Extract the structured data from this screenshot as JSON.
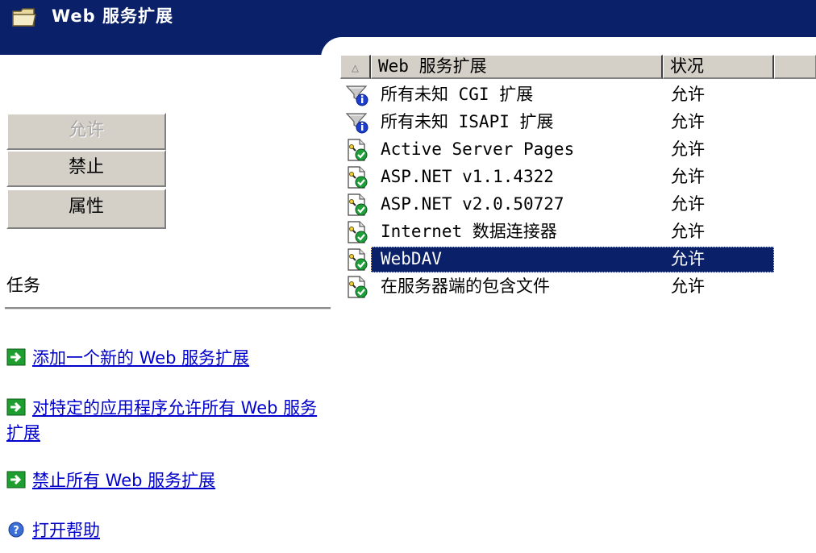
{
  "header": {
    "title": "Web 服务扩展"
  },
  "left_panel": {
    "buttons": [
      {
        "label": "允许",
        "enabled": false
      },
      {
        "label": "禁止",
        "enabled": true
      },
      {
        "label": "属性",
        "enabled": true
      }
    ],
    "tasks_title": "任务",
    "tasks": [
      {
        "label": "添加一个新的 Web 服务扩展",
        "icon": "green-arrow-icon"
      },
      {
        "label": "对特定的应用程序允许所有 Web 服务扩展",
        "icon": "green-arrow-icon"
      },
      {
        "label": "禁止所有 Web 服务扩展",
        "icon": "green-arrow-icon"
      },
      {
        "label": "打开帮助",
        "icon": "help-icon"
      }
    ]
  },
  "list": {
    "columns": {
      "name": "Web 服务扩展",
      "status": "状况"
    },
    "sort_indicator": "△",
    "rows": [
      {
        "name": "所有未知 CGI 扩展",
        "status": "允许",
        "icon": "filter-info-icon",
        "selected": false
      },
      {
        "name": "所有未知 ISAPI 扩展",
        "status": "允许",
        "icon": "filter-info-icon",
        "selected": false
      },
      {
        "name": "Active Server Pages",
        "status": "允许",
        "icon": "document-check-icon",
        "selected": false
      },
      {
        "name": "ASP.NET v1.1.4322",
        "status": "允许",
        "icon": "document-check-icon",
        "selected": false
      },
      {
        "name": "ASP.NET v2.0.50727",
        "status": "允许",
        "icon": "document-check-icon",
        "selected": false
      },
      {
        "name": "Internet 数据连接器",
        "status": "允许",
        "icon": "document-check-icon",
        "selected": false
      },
      {
        "name": "WebDAV",
        "status": "允许",
        "icon": "document-check-icon",
        "selected": true
      },
      {
        "name": "在服务器端的包含文件",
        "status": "允许",
        "icon": "document-check-icon",
        "selected": false
      }
    ]
  },
  "colors": {
    "header_bg": "#0a2069",
    "link": "#0000cc",
    "button_face": "#d4d0c8",
    "selection": "#0a2069"
  }
}
